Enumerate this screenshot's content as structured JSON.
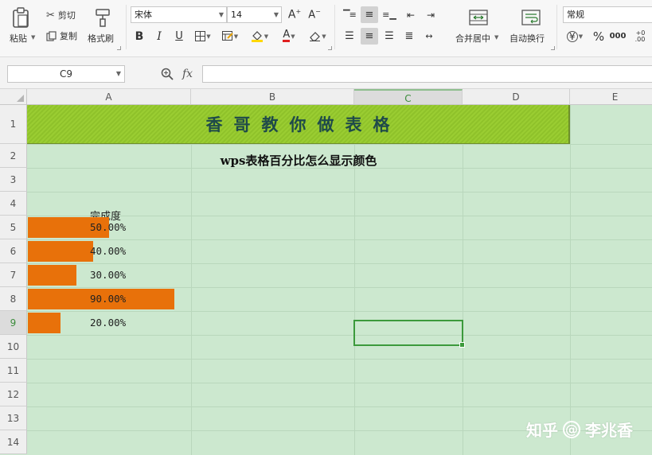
{
  "ribbon": {
    "clipboard": {
      "paste": "粘贴",
      "cut": "剪切",
      "copy": "复制",
      "format_painter": "格式刷"
    },
    "font": {
      "name": "宋体",
      "size": "14"
    },
    "align": {
      "merge_center": "合并居中",
      "wrap_text": "自动换行"
    },
    "number": {
      "format": "常规"
    }
  },
  "formula_bar": {
    "name_box": "C9",
    "fx": "fx",
    "value": ""
  },
  "sheet": {
    "columns": [
      "A",
      "B",
      "C",
      "D",
      "E"
    ],
    "selected_column": "C",
    "rows": [
      "1",
      "2",
      "3",
      "4",
      "5",
      "6",
      "7",
      "8",
      "9",
      "10",
      "11",
      "12",
      "13",
      "14"
    ],
    "selected_row": "9",
    "banner": "香哥教你做表格",
    "subtitle": "wps表格百分比怎么显示颜色",
    "header": "完成度",
    "completion": [
      {
        "label": "50.00%",
        "value": 0.5
      },
      {
        "label": "40.00%",
        "value": 0.4
      },
      {
        "label": "30.00%",
        "value": 0.3
      },
      {
        "label": "90.00%",
        "value": 0.9
      },
      {
        "label": "20.00%",
        "value": 0.2
      }
    ],
    "bar_color": "#e8710a",
    "grid_bg": "#cce8cf"
  },
  "watermark": {
    "site": "知乎",
    "author": "李兆香"
  }
}
